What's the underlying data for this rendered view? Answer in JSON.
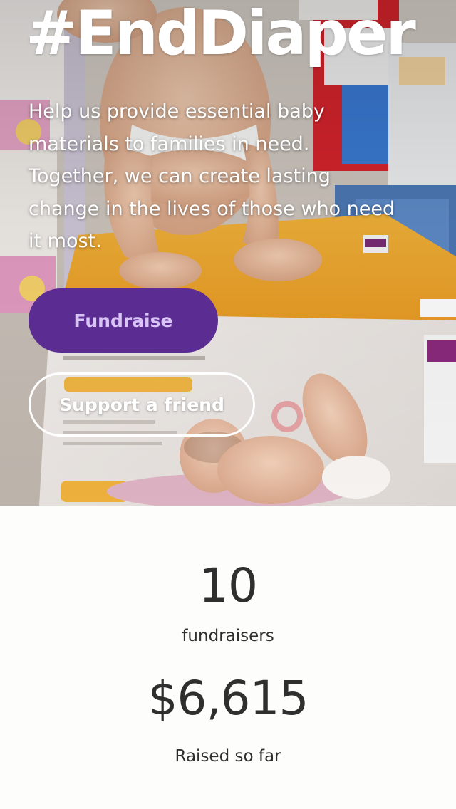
{
  "hero": {
    "title": "#EndDiaper",
    "description": "Help us provide essential baby materials to families in need. Together, we can create lasting change in the lives of those who need it most.",
    "fundraise_label": "Fundraise",
    "support_label": "Support a friend",
    "fundraise_color": "#5b2c91",
    "fundraise_text_color": "#d9c4f6"
  },
  "stats": {
    "fundraisers_count": "10",
    "fundraisers_label": "fundraisers",
    "raised_amount": "$6,615",
    "raised_label": "Raised so far"
  }
}
